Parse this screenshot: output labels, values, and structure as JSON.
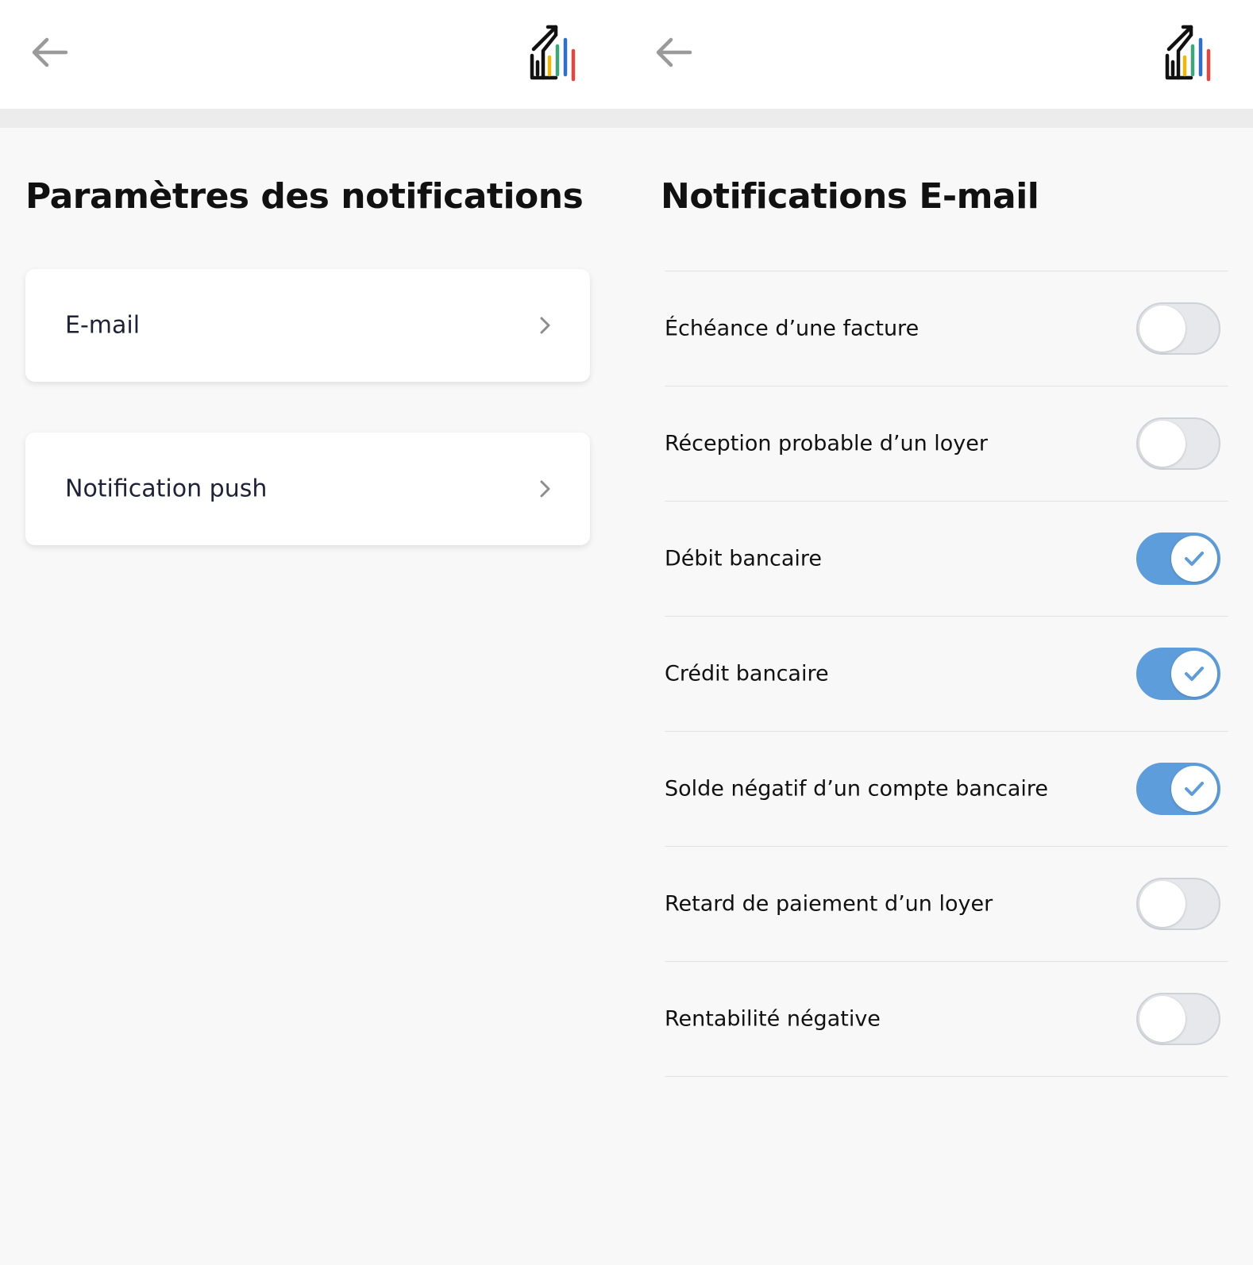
{
  "colors": {
    "accent": "#5d9ddc",
    "background": "#f8f8f8",
    "header": "#ffffff",
    "toggle_off": "#e7e8ec",
    "logo_bars": [
      "#f2b705",
      "#3aa87a",
      "#2d6fd0",
      "#e2463c"
    ]
  },
  "left_screen": {
    "header": {
      "back_icon": "arrow-left-icon",
      "logo": "house-chart-logo"
    },
    "title": "Paramètres des notifications",
    "options": [
      {
        "label": "E-mail",
        "icon": "chevron-right-icon"
      },
      {
        "label": "Notification push",
        "icon": "chevron-right-icon"
      }
    ]
  },
  "right_screen": {
    "header": {
      "back_icon": "arrow-left-icon",
      "logo": "house-chart-logo"
    },
    "title": "Notifications E-mail",
    "settings": [
      {
        "label": "Échéance d’une facture",
        "enabled": false
      },
      {
        "label": "Réception probable d’un loyer",
        "enabled": false
      },
      {
        "label": "Débit bancaire",
        "enabled": true
      },
      {
        "label": "Crédit bancaire",
        "enabled": true
      },
      {
        "label": "Solde négatif d’un compte bancaire",
        "enabled": true
      },
      {
        "label": "Retard de paiement d’un loyer",
        "enabled": false
      },
      {
        "label": "Rentabilité négative",
        "enabled": false
      }
    ]
  }
}
